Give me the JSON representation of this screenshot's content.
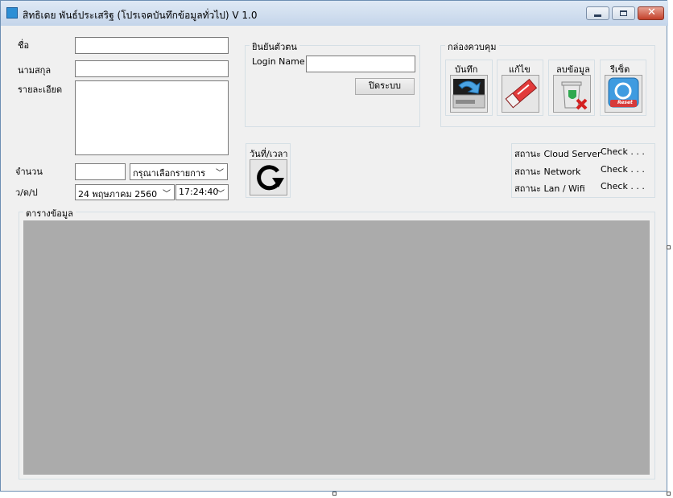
{
  "window": {
    "title": "สิทธิเดย พันธ์ประเสริฐ (โปรเจคบันทึกข้อมูลทั่วไป) V 1.0"
  },
  "form": {
    "name_label": "ชื่อ",
    "surname_label": "นามสกุล",
    "detail_label": "รายละเอียด",
    "amount_label": "จำนวน",
    "item_select_value": "กรุณาเลือกรายการ",
    "date_label": "ว/ด/ป",
    "date_value": "24  พฤษภาคม    2560",
    "time_value": "17:24:40"
  },
  "auth": {
    "group_title": "ยินยันตัวตน",
    "login_label": "Login Name",
    "close_button": "ปิดระบบ"
  },
  "controls": {
    "group_title": "กล่องควบคุม",
    "buttons": [
      {
        "label": "บันทึก",
        "icon": "save-icon"
      },
      {
        "label": "แก้ไข",
        "icon": "eraser-icon"
      },
      {
        "label": "ลบข้อมูล",
        "icon": "delete-icon"
      },
      {
        "label": "รีเซ็ต",
        "icon": "reset-icon",
        "badge": "Reset"
      }
    ]
  },
  "datetime": {
    "title": "วันที่/เวลา",
    "icon": "refresh-icon"
  },
  "status": {
    "rows": [
      {
        "label": "สถานะ Cloud Server",
        "value": "Check . . ."
      },
      {
        "label": "สถานะ Network",
        "value": "Check . . ."
      },
      {
        "label": "สถานะ Lan / Wifi",
        "value": "Check . . ."
      }
    ]
  },
  "table": {
    "group_title": "ตารางข้อมูล"
  }
}
